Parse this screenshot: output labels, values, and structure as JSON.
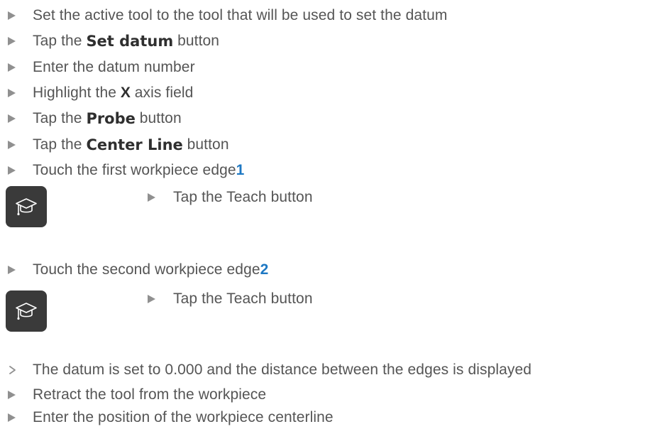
{
  "steps": [
    {
      "prefix": "Set the active tool to the tool that will be used to set the datum"
    },
    {
      "prefix": "Tap the ",
      "bold": "Set datum",
      "suffix": " button"
    },
    {
      "prefix": "Enter the datum number"
    },
    {
      "prefix": "Highlight the ",
      "bold": "X",
      "suffix": " axis field"
    },
    {
      "prefix": "Tap the ",
      "bold": "Probe",
      "suffix": " button"
    },
    {
      "prefix": "Tap the ",
      "bold": "Center Line",
      "suffix": " button"
    },
    {
      "prefix": "Touch the first workpiece edge ",
      "ref": "1"
    }
  ],
  "teach1": {
    "icon": "graduation-cap-icon",
    "text": "Tap the Teach button"
  },
  "step_second_edge": {
    "prefix": "Touch the second workpiece edge ",
    "ref": "2"
  },
  "teach2": {
    "icon": "graduation-cap-icon",
    "text": "Tap the Teach button"
  },
  "result": {
    "text": "The datum is set to 0.000 and the distance between the edges is displayed"
  },
  "final_steps": [
    {
      "text": "Retract the tool from the workpiece"
    },
    {
      "text": "Enter the position of the workpiece centerline"
    }
  ],
  "colors": {
    "text": "#555555",
    "marker": "#909090",
    "ref": "#1d78c3",
    "icon_bg": "#3a3a3a"
  }
}
